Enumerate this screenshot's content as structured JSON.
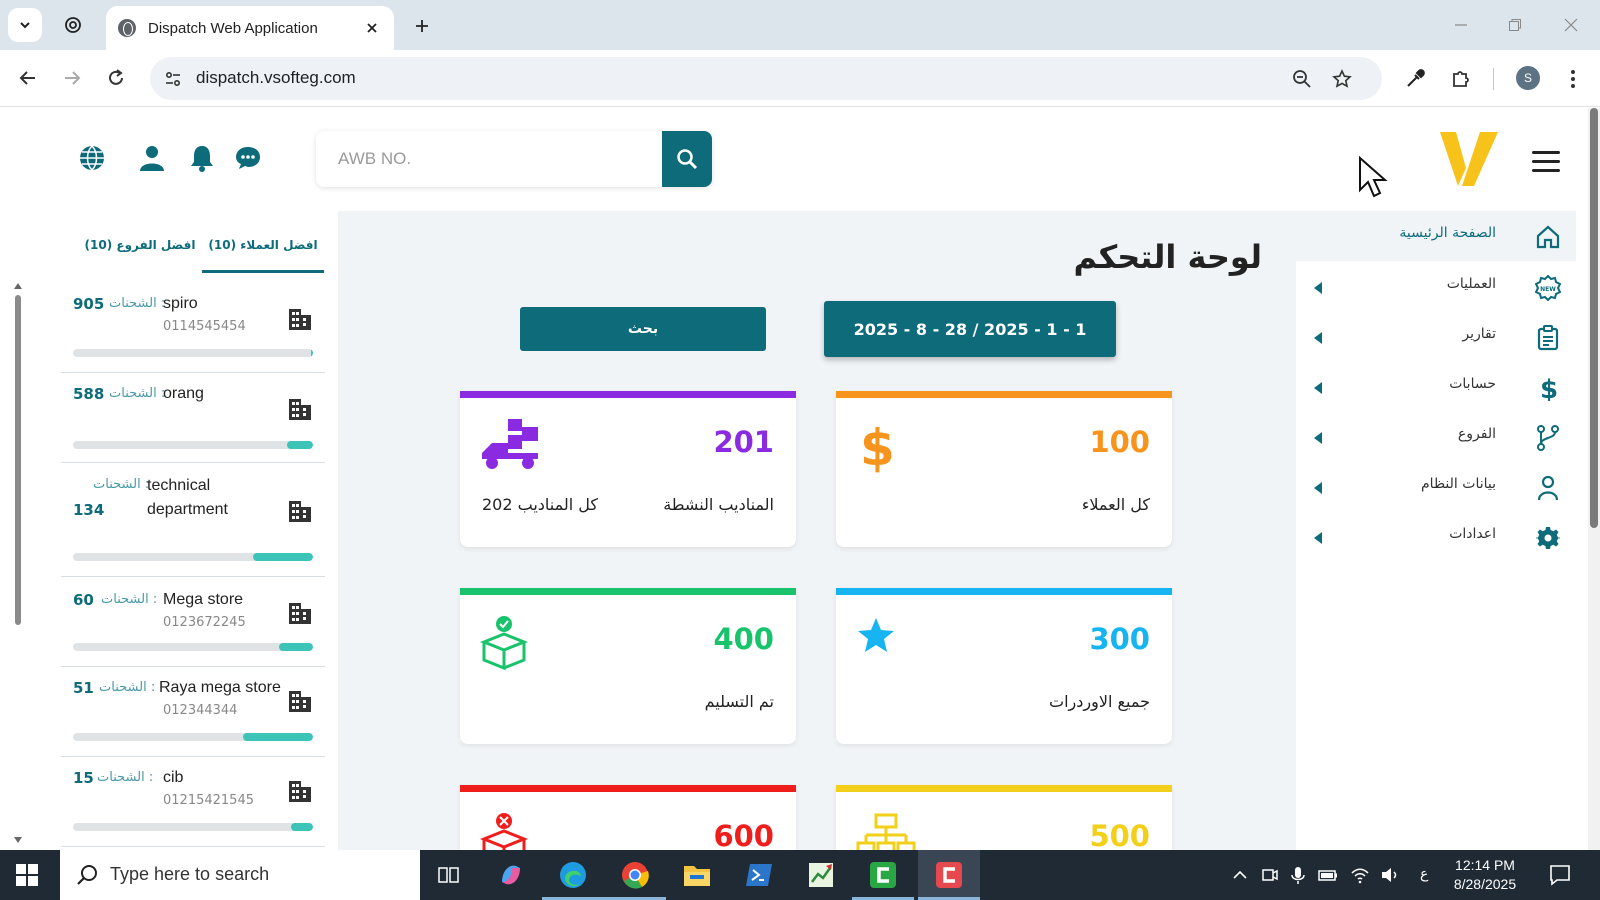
{
  "browser": {
    "tab_title": "Dispatch Web Application",
    "url": "dispatch.vsofteg.com",
    "profile_initial": "S"
  },
  "header": {
    "search_placeholder": "AWB NO."
  },
  "left_panel": {
    "tabs": [
      {
        "label": "افضل العملاء (10)",
        "active": true
      },
      {
        "label": "افضل الفروع (10)",
        "active": false
      }
    ],
    "count_label": "الشحنات :",
    "clients": [
      {
        "name": "spiro",
        "phone": "0114545454",
        "count": "905",
        "progress": 0.01
      },
      {
        "name": "orang",
        "phone": "",
        "count": "588",
        "progress": 0.11
      },
      {
        "name": "technical department",
        "name_line1": "technical",
        "name_line2": "department",
        "phone": "",
        "count": "134",
        "progress": 0.25
      },
      {
        "name": "Mega store",
        "phone": "0123672245",
        "count": "60",
        "progress": 0.14
      },
      {
        "name": "Raya mega store",
        "phone": "012344344",
        "count": "51",
        "progress": 0.29
      },
      {
        "name": "cib",
        "phone": "01215421545",
        "count": "15",
        "progress": 0.09
      }
    ]
  },
  "sidebar": {
    "items": [
      {
        "label": "الصفحة الرئيسية",
        "icon": "home-icon",
        "active": true,
        "has_caret": false
      },
      {
        "label": "العمليات",
        "icon": "new-badge-icon",
        "active": false,
        "has_caret": true
      },
      {
        "label": "تقارير",
        "icon": "clipboard-icon",
        "active": false,
        "has_caret": true
      },
      {
        "label": "حسابات",
        "icon": "dollar-icon",
        "active": false,
        "has_caret": true
      },
      {
        "label": "الفروع",
        "icon": "branch-icon",
        "active": false,
        "has_caret": true
      },
      {
        "label": "بيانات النظام",
        "icon": "user-icon",
        "active": false,
        "has_caret": true
      },
      {
        "label": "اعدادات",
        "icon": "gear-icon",
        "active": false,
        "has_caret": true
      }
    ]
  },
  "dashboard": {
    "title": "لوحة التحكم",
    "date_range": "2025 - 8 - 28 / 2025 - 1 - 1",
    "search_button": "بحث",
    "cards": [
      {
        "value": "100",
        "caption": "كل العملاء",
        "color": "#f7941d",
        "icon": "dollar-icon"
      },
      {
        "value": "201",
        "caption": "المناديب النشطة",
        "caption2": "كل المناديب 202",
        "color": "#8a2be2",
        "icon": "delivery-icon"
      },
      {
        "value": "300",
        "caption": "جميع الاوردرات",
        "color": "#16b4f0",
        "icon": "star-icon"
      },
      {
        "value": "400",
        "caption": "تم التسليم",
        "color": "#19c36b",
        "icon": "box-check-icon"
      },
      {
        "value": "500",
        "caption": "",
        "color": "#f2d01a",
        "icon": "hierarchy-icon"
      },
      {
        "value": "600",
        "caption": "",
        "color": "#f01d1d",
        "icon": "box-cancel-icon"
      }
    ]
  },
  "taskbar": {
    "search_placeholder": "Type here to search",
    "time": "12:14 PM",
    "date": "8/28/2025",
    "lang": "ع"
  },
  "colors": {
    "primary": "#0d6b7a",
    "accent_logo": "#f7c31a"
  }
}
